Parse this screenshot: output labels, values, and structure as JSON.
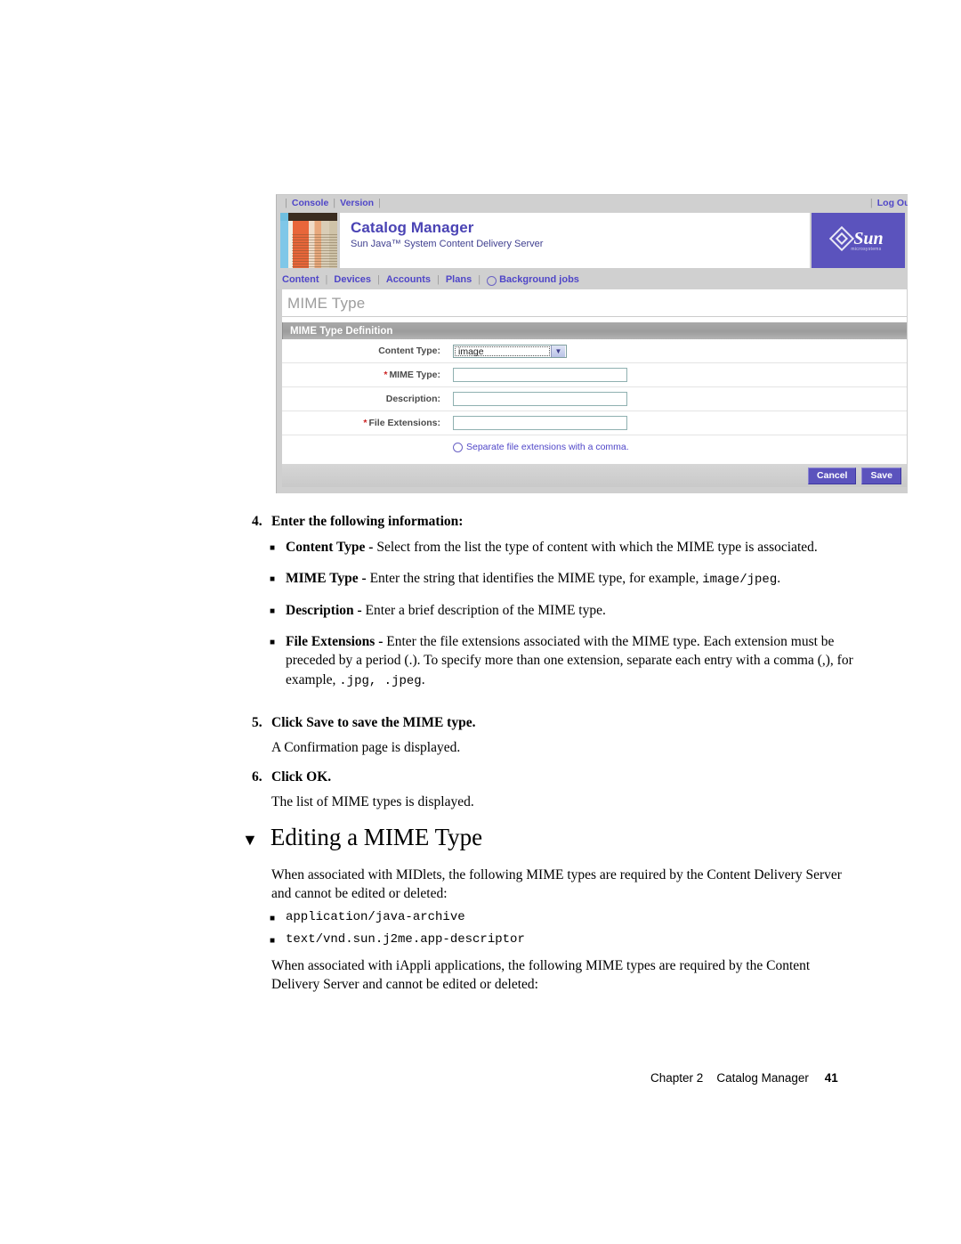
{
  "screenshot": {
    "topbar": {
      "console_link": "Console",
      "version_link": "Version",
      "logout_link": "Log Out"
    },
    "banner": {
      "title": "Catalog Manager",
      "subtitle": "Sun Java™ System Content Delivery Server",
      "logo_word": "Sun",
      "logo_sub": "microsystems"
    },
    "nav": {
      "items": [
        {
          "label": "Content"
        },
        {
          "label": "Devices"
        },
        {
          "label": "Accounts"
        },
        {
          "label": "Plans"
        },
        {
          "label": "Background jobs"
        }
      ],
      "separator": "|"
    },
    "page_title": "MIME Type",
    "panel": {
      "header": "MIME Type Definition",
      "fields": [
        {
          "label": "Content Type:",
          "required": false,
          "control": "select",
          "value": "image"
        },
        {
          "label": "MIME Type:",
          "required": true,
          "control": "text",
          "value": ""
        },
        {
          "label": "Description:",
          "required": false,
          "control": "text",
          "value": ""
        },
        {
          "label": "File Extensions:",
          "required": true,
          "control": "text",
          "value": ""
        }
      ],
      "hint": "Separate file extensions with a comma.",
      "cancel_button": "Cancel",
      "save_button": "Save"
    },
    "colors": {
      "brand_purple": "#5b53bd",
      "link_purple": "#4f46c8",
      "required_red": "#cc2222",
      "panel_gray": "#9c9c9c"
    }
  },
  "document": {
    "step4": {
      "num": "4.",
      "text": "Enter the following information:"
    },
    "step4_bullets": [
      {
        "term": "Content Type - ",
        "body": "Select from the list the type of content with which the MIME type is associated."
      },
      {
        "term": "MIME Type - ",
        "body": "Enter the string that identifies the MIME type, for example, ",
        "code": "image/jpeg",
        "tail": "."
      },
      {
        "term": "Description - ",
        "body": "Enter a brief description of the MIME type."
      },
      {
        "term": "File Extensions - ",
        "body": "Enter the file extensions associated with the MIME type. Each extension must be preceded by a period (.). To specify more than one extension, separate each entry with a comma (,), for example, ",
        "code": ".jpg,  .jpeg",
        "tail": "."
      }
    ],
    "step5": {
      "num": "5.",
      "text_pre": "Click ",
      "text_bold": "Save",
      "text_post": " to save the MIME type.",
      "result": "A Confirmation page is displayed."
    },
    "step6": {
      "num": "6.",
      "text": "Click OK.",
      "result": "The list of MIME types is displayed."
    },
    "heading": {
      "marker": "▼",
      "text": "Editing a MIME Type"
    },
    "midlets_para": "When associated with MIDlets, the following MIME types are required by the Content Delivery Server and cannot be edited or deleted:",
    "midlets_types": [
      "application/java-archive",
      "text/vnd.sun.j2me.app-descriptor"
    ],
    "iappli_para": "When associated with iAppli applications, the following MIME types are required by the Content Delivery Server and cannot be edited or deleted:"
  },
  "footer": {
    "chapter": "Chapter 2",
    "title": "Catalog Manager",
    "page": "41"
  }
}
